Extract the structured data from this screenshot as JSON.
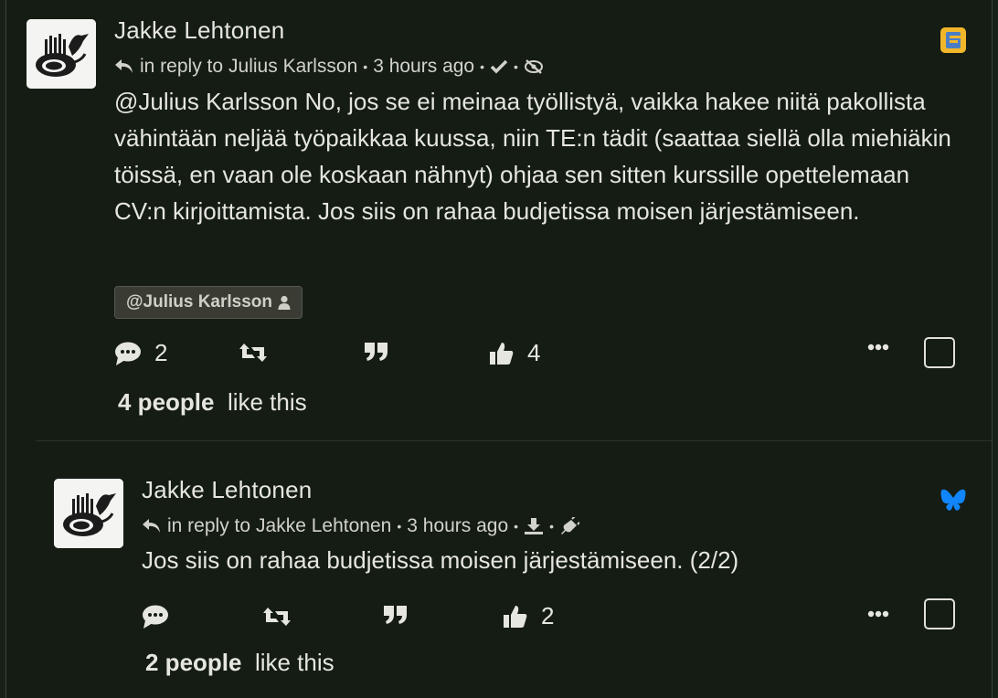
{
  "posts": [
    {
      "author": "Jakke Lehtonen",
      "reply_prefix": "in reply to",
      "reply_to": "Julius Karlsson",
      "time": "3 hours ago",
      "network_icon": "friendica-icon",
      "body": "@Julius Karlsson No, jos se ei meinaa työllistyä, vaikka hakee niitä pakollista vähintään neljää työpaikkaa kuussa, niin TE:n tädit (saattaa siellä olla miehiäkin töissä, en vaan ole koskaan nähnyt) ohjaa sen sitten kurssille opettelemaan CV:n kirjoittamista. Jos siis on rahaa budjetissa moisen järjestämiseen.",
      "mention_tag": "@Julius Karlsson",
      "comment_count": "2",
      "like_count": "4",
      "likes_count_text": "4 people",
      "likes_suffix": "like this"
    },
    {
      "author": "Jakke Lehtonen",
      "reply_prefix": "in reply to",
      "reply_to": "Jakke Lehtonen",
      "time": "3 hours ago",
      "network_icon": "bluesky-icon",
      "body": "Jos siis on rahaa budjetissa moisen järjestämiseen. (2/2)",
      "like_count": "2",
      "likes_count_text": "2 people",
      "likes_suffix": "like this"
    }
  ],
  "colors": {
    "background": "#141c14",
    "text": "#e6e6e0",
    "bluesky": "#1185fe",
    "friendica_yellow": "#f1b62a",
    "friendica_blue": "#4a7ec4"
  }
}
